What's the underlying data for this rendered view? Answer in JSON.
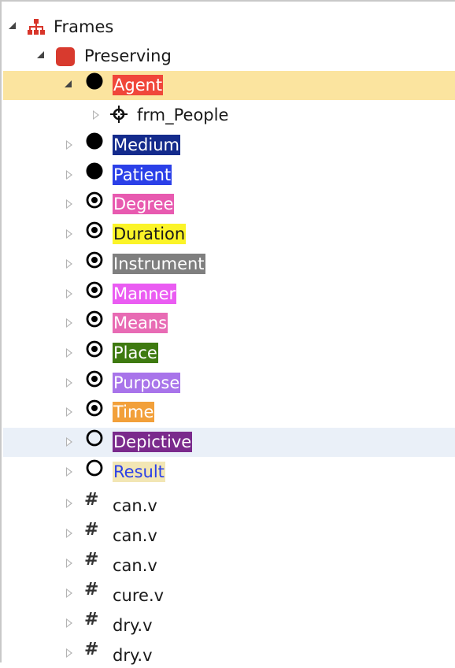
{
  "tree": {
    "root_label": "Frames",
    "frame_label": "Preserving",
    "child_label": "frm_People",
    "elements": [
      {
        "label": "Agent",
        "bg": "#f0463a",
        "fg": "#ffffff",
        "icon": "filled-circle-icon"
      },
      {
        "label": "Medium",
        "bg": "#142b8c",
        "fg": "#ffffff",
        "icon": "filled-circle-icon"
      },
      {
        "label": "Patient",
        "bg": "#2b40e8",
        "fg": "#ffffff",
        "icon": "filled-circle-icon"
      },
      {
        "label": "Degree",
        "bg": "#e85ab0",
        "fg": "#ffffff",
        "icon": "dot-circle-icon"
      },
      {
        "label": "Duration",
        "bg": "#fbf428",
        "fg": "#1a1a1a",
        "icon": "dot-circle-icon"
      },
      {
        "label": "Instrument",
        "bg": "#7f7f7f",
        "fg": "#ffffff",
        "icon": "dot-circle-icon"
      },
      {
        "label": "Manner",
        "bg": "#ea5cf2",
        "fg": "#ffffff",
        "icon": "dot-circle-icon"
      },
      {
        "label": "Means",
        "bg": "#e86bb4",
        "fg": "#ffffff",
        "icon": "dot-circle-icon"
      },
      {
        "label": "Place",
        "bg": "#3e7a10",
        "fg": "#ffffff",
        "icon": "dot-circle-icon"
      },
      {
        "label": "Purpose",
        "bg": "#a874ea",
        "fg": "#ffffff",
        "icon": "dot-circle-icon"
      },
      {
        "label": "Time",
        "bg": "#f2a03a",
        "fg": "#ffffff",
        "icon": "dot-circle-icon"
      },
      {
        "label": "Depictive",
        "bg": "#7a2a8c",
        "fg": "#ffffff",
        "icon": "empty-circle-icon"
      },
      {
        "label": "Result",
        "bg": "#f2e6b4",
        "fg": "#2b40e8",
        "icon": "empty-circle-icon"
      }
    ],
    "lexical_units": [
      "can.v",
      "can.v",
      "can.v",
      "cure.v",
      "dry.v",
      "dry.v"
    ]
  },
  "colors": {
    "selected_row": "#fbe49f",
    "hover_row": "#eaf0f8",
    "frames_icon": "#d8352a",
    "frame_icon": "#d83a2e"
  }
}
